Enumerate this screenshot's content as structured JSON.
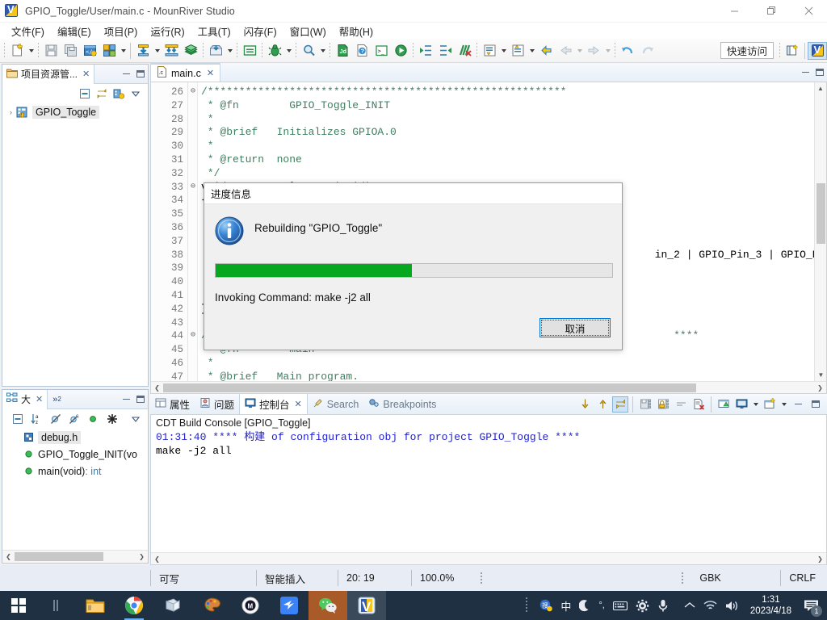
{
  "window": {
    "title": "GPIO_Toggle/User/main.c - MounRiver Studio",
    "icon": "mounriver-logo-icon",
    "buttons": {
      "minimize": "—",
      "restore": "❐",
      "close": "✕"
    }
  },
  "menubar": {
    "items": [
      {
        "label": "文件(F)",
        "name": "menu-file"
      },
      {
        "label": "编辑(E)",
        "name": "menu-edit"
      },
      {
        "label": "项目(P)",
        "name": "menu-project"
      },
      {
        "label": "运行(R)",
        "name": "menu-run"
      },
      {
        "label": "工具(T)",
        "name": "menu-tools"
      },
      {
        "label": "闪存(F)",
        "name": "menu-flash"
      },
      {
        "label": "窗口(W)",
        "name": "menu-window"
      },
      {
        "label": "帮助(H)",
        "name": "menu-help"
      }
    ]
  },
  "toolbar": {
    "quick_access": "快速访问",
    "icons": [
      "new-file-icon",
      "save-icon",
      "save-all-icon",
      "build-config-icon",
      "build-all-icon",
      "download-icon",
      "download-all-icon",
      "library-icon",
      "import-icon",
      "terminal-window-icon",
      "debug-bug-icon",
      "search-icon",
      "javadoc-icon",
      "help-icon",
      "console-icon",
      "run-icon",
      "refresh-icon",
      "indent-icon",
      "outdent-icon",
      "clear-marks-icon",
      "next-annotation-icon",
      "prev-annotation-icon",
      "back-icon",
      "forward-icon",
      "undo-arrow-icon",
      "redo-arrow-icon",
      "open-perspective-icon",
      "perspective-mrs-icon"
    ]
  },
  "project_explorer": {
    "tab_label": "项目资源管...",
    "tab_icon": "project-folder-icon",
    "close_icon": "close-icon",
    "minimize_icon": "minimize-icon",
    "maximize_icon": "maximize-icon",
    "toolbar_icons": [
      "collapse-all-icon",
      "link-editor-icon",
      "view-menu-build-icon",
      "view-menu-icon"
    ],
    "tree": [
      {
        "label": "GPIO_Toggle",
        "icon": "c-project-icon",
        "expand_arrow": "›",
        "selected": true
      }
    ]
  },
  "outline": {
    "tab_label": "大",
    "tab_icon": "outline-icon",
    "close_icon": "close-icon",
    "overflow_label": "»",
    "overflow_count": "2",
    "toolbar_icons": [
      "collapse-all-icon",
      "sort-az-icon",
      "hide-fields-icon",
      "hide-static-icon",
      "hide-nonpublic-icon",
      "hide-local-icon",
      "view-menu-icon"
    ],
    "items": [
      {
        "label": "debug.h",
        "icon": "include-header-icon",
        "selected": true,
        "type": ""
      },
      {
        "label": "GPIO_Toggle_INIT(vo",
        "icon": "public-method-icon",
        "type": ""
      },
      {
        "label": "main(void)",
        "icon": "public-method-icon",
        "type": " : int"
      }
    ]
  },
  "editor": {
    "tab_label": "main.c",
    "tab_icon": "c-file-icon",
    "close_icon": "close-icon",
    "minimize_icon": "minimize-icon",
    "maximize_icon": "maximize-icon",
    "lines": [
      {
        "num": "26",
        "fold": "⊖",
        "text": "/*********************************************************",
        "cls": "cmt"
      },
      {
        "num": "27",
        "fold": "",
        "text": " * @fn        GPIO_Toggle_INIT",
        "cls": "cmt"
      },
      {
        "num": "28",
        "fold": "",
        "text": " *",
        "cls": "cmt"
      },
      {
        "num": "29",
        "fold": "",
        "text": " * @brief   Initializes GPIOA.0",
        "cls": "cmt"
      },
      {
        "num": "30",
        "fold": "",
        "text": " *",
        "cls": "cmt"
      },
      {
        "num": "31",
        "fold": "",
        "text": " * @return  none",
        "cls": "cmt"
      },
      {
        "num": "32",
        "fold": "",
        "text": " */",
        "cls": "cmt"
      },
      {
        "num": "33",
        "fold": "⊖",
        "text": "void GPIO_Toggle_INIT(void)",
        "cls": "plain"
      },
      {
        "num": "34",
        "fold": "",
        "text": "{",
        "cls": "plain"
      },
      {
        "num": "35",
        "fold": "",
        "text": "",
        "cls": "plain"
      },
      {
        "num": "36",
        "fold": "",
        "text": "",
        "cls": "plain"
      },
      {
        "num": "37",
        "fold": "",
        "text": "",
        "cls": "plain"
      },
      {
        "num": "38",
        "fold": "",
        "text": "                                                                        in_2 | GPIO_Pin_3 | GPIO_Pi",
        "cls": "plain"
      },
      {
        "num": "39",
        "fold": "",
        "text": "",
        "cls": "plain"
      },
      {
        "num": "40",
        "fold": "",
        "text": "",
        "cls": "plain"
      },
      {
        "num": "41",
        "fold": "",
        "text": "",
        "cls": "plain"
      },
      {
        "num": "42",
        "fold": "",
        "text": "}",
        "cls": "plain"
      },
      {
        "num": "43",
        "fold": "",
        "text": "",
        "cls": "plain"
      },
      {
        "num": "44",
        "fold": "⊖",
        "text": "/*                                                                         ****",
        "cls": "cmt"
      },
      {
        "num": "45",
        "fold": "",
        "text": " * @fn        main",
        "cls": "cmt"
      },
      {
        "num": "46",
        "fold": "",
        "text": " *",
        "cls": "cmt"
      },
      {
        "num": "47",
        "fold": "",
        "text": " * @brief   Main program.",
        "cls": "cmt"
      }
    ]
  },
  "console": {
    "tabs": [
      {
        "label": "属性",
        "icon": "properties-icon",
        "active": false
      },
      {
        "label": "问题",
        "icon": "problems-icon",
        "active": false
      },
      {
        "label": "控制台",
        "icon": "console-icon",
        "active": true,
        "close_icon": "close-icon"
      },
      {
        "label": "Search",
        "icon": "search-pin-icon",
        "active": false
      },
      {
        "label": "Breakpoints",
        "icon": "breakpoints-icon",
        "active": false
      }
    ],
    "toolbar_icons": [
      "scroll-lock-down-icon",
      "scroll-lock-up-icon",
      "link-icon",
      "save-console-icon",
      "lock-console-icon",
      "wrap-icon",
      "clear-console-icon",
      "pin-console-icon",
      "display-console-icon",
      "display-dropdown-icon",
      "new-console-icon",
      "new-console-dropdown-icon",
      "minimize-icon",
      "maximize-icon"
    ],
    "title": "CDT Build Console [GPIO_Toggle]",
    "lines": [
      {
        "parts": [
          {
            "text": "01:31:40 **** ",
            "style": "blue"
          },
          {
            "text": "构建",
            "style": "blue"
          },
          {
            "text": " of configuration obj for project GPIO_Toggle ****",
            "style": "blue"
          }
        ]
      },
      {
        "parts": [
          {
            "text": "make -j2 all",
            "style": "black"
          }
        ]
      }
    ]
  },
  "statusbar": {
    "writable": "可写",
    "insert_mode": "智能插入",
    "cursor_position": "20: 19",
    "zoom": "100.0%",
    "encoding": "GBK",
    "line_ending": "CRLF"
  },
  "dialog": {
    "title": "进度信息",
    "icon": "info-icon",
    "message": "Rebuilding \"GPIO_Toggle\"",
    "sub_message": "Invoking Command: make -j2 all",
    "progress_percent": 49.5,
    "progress_color": "#06a81f",
    "cancel_label": "取消"
  },
  "taskbar": {
    "start_icon": "windows-start-icon",
    "items": [
      {
        "name": "taskview-icon",
        "icon": "task-view"
      },
      {
        "name": "file-explorer-icon",
        "icon": "folder"
      },
      {
        "name": "chrome-icon",
        "icon": "chrome",
        "running": true
      },
      {
        "name": "sticky-notes-icon",
        "icon": "notes"
      },
      {
        "name": "paint-icon",
        "icon": "paint"
      },
      {
        "name": "app-circle-icon",
        "icon": "circle-app"
      },
      {
        "name": "blue-bird-icon",
        "icon": "bird"
      },
      {
        "name": "wechat-icon",
        "icon": "wechat",
        "active": true
      },
      {
        "name": "mounriver-studio-icon",
        "icon": "mrs",
        "active": true
      }
    ],
    "tray": {
      "icons": [
        "ime-logo-icon",
        "ime-chinese-icon",
        "ime-moon-icon",
        "ime-punct-icon",
        "keyboard-icon",
        "settings-gear-icon",
        "microphone-icon",
        "show-hidden-icon",
        "wifi-icon",
        "volume-icon"
      ],
      "ime_chinese": "中",
      "time": "1:31",
      "date": "2023/4/18",
      "notification_count": "1"
    }
  }
}
